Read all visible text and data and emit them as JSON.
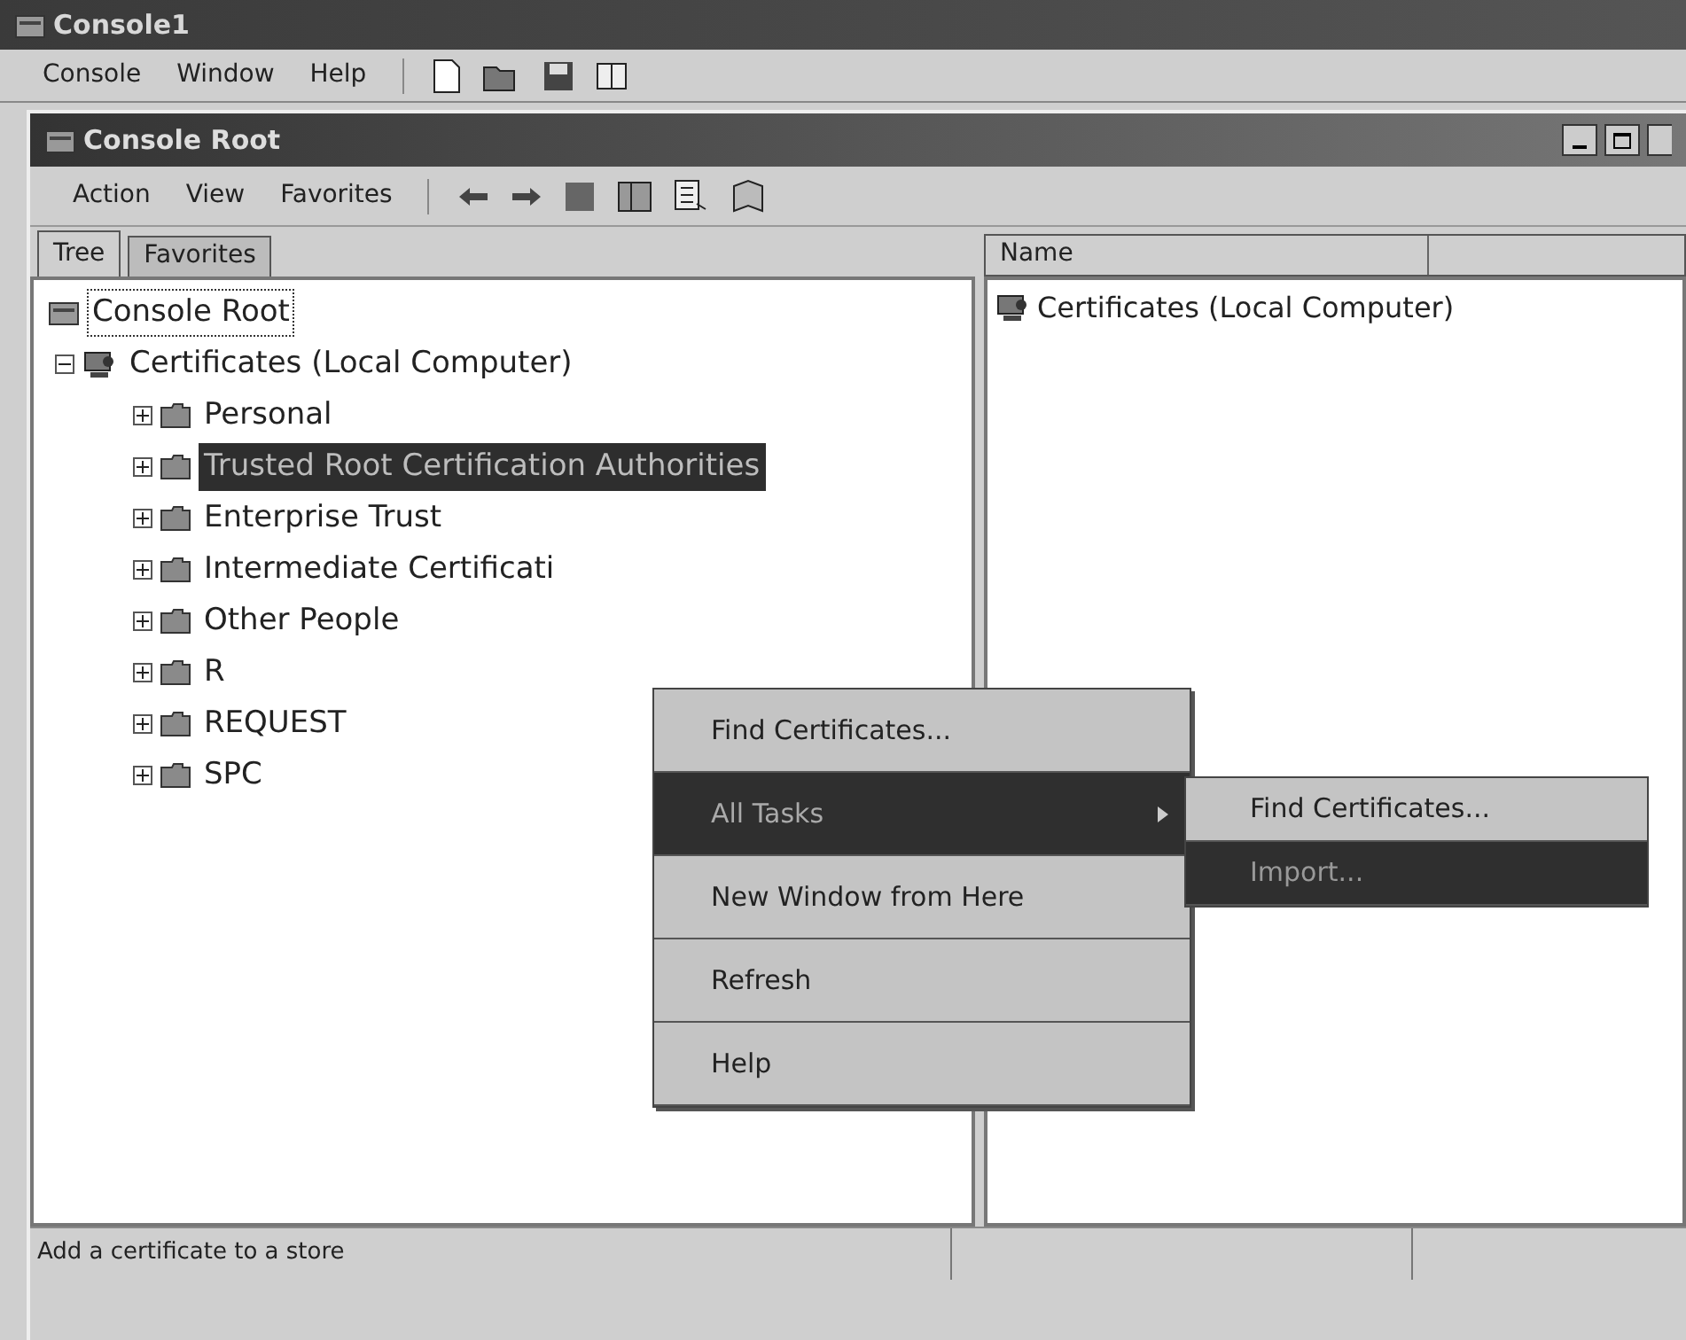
{
  "window": {
    "title": "Console1"
  },
  "menu_bar": [
    "Console",
    "Window",
    "Help"
  ],
  "child_window": {
    "title": "Console Root"
  },
  "child_menu": [
    "Action",
    "View",
    "Favorites"
  ],
  "tabs": [
    {
      "label": "Tree",
      "selected": true
    },
    {
      "label": "Favorites",
      "selected": false
    }
  ],
  "tree": [
    {
      "label": "Console Root",
      "selected": false,
      "focused": true,
      "kind": "console",
      "children": [
        {
          "label": "Certificates (Local Computer)",
          "selected": false,
          "expanded": true,
          "kind": "cert",
          "children": [
            {
              "label": "Personal",
              "selected": false,
              "expanded": false,
              "kind": "folder"
            },
            {
              "label": "Trusted Root Certification Authorities",
              "selected": true,
              "expanded": false,
              "kind": "folder"
            },
            {
              "label": "Enterprise Trust",
              "selected": false,
              "expanded": false,
              "kind": "folder"
            },
            {
              "label": "Intermediate Certificati",
              "selected": false,
              "expanded": false,
              "kind": "folder"
            },
            {
              "label": "Other People",
              "selected": false,
              "expanded": false,
              "kind": "folder"
            },
            {
              "label": "R",
              "selected": false,
              "expanded": false,
              "kind": "folder"
            },
            {
              "label": "REQUEST",
              "selected": false,
              "expanded": false,
              "kind": "folder"
            },
            {
              "label": "SPC",
              "selected": false,
              "expanded": false,
              "kind": "folder"
            }
          ]
        }
      ]
    }
  ],
  "list": {
    "columns": [
      "Name"
    ],
    "rows": [
      "Certificates (Local Computer)"
    ]
  },
  "context_menu": [
    {
      "label": "Find Certificates...",
      "kind": "item",
      "selected": false
    },
    {
      "label": "All Tasks",
      "kind": "submenu",
      "selected": true
    },
    {
      "label": "New Window from Here",
      "kind": "item",
      "selected": false
    },
    {
      "label": "Refresh",
      "kind": "item",
      "selected": false
    },
    {
      "label": "Help",
      "kind": "item",
      "selected": false
    }
  ],
  "submenu": [
    {
      "label": "Find Certificates...",
      "selected": false
    },
    {
      "label": "Import...",
      "selected": true
    }
  ],
  "status_bar": "Add a certificate to a store"
}
